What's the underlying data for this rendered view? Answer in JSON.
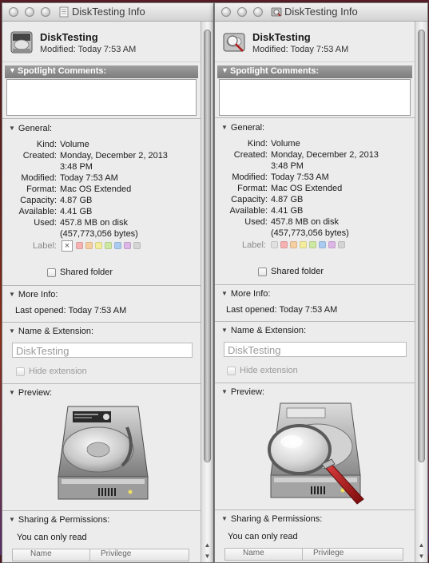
{
  "windows": [
    {
      "id": "left",
      "title": "DiskTesting Info",
      "name": "DiskTesting",
      "modified": "Modified: Today 7:53 AM",
      "spotlight_label": "Spotlight Comments:",
      "general_label": "General:",
      "general": [
        {
          "key": "Kind:",
          "value": "Volume"
        },
        {
          "key": "Created:",
          "value": "Monday, December 2, 2013"
        },
        {
          "key": "",
          "value": "3:48 PM"
        },
        {
          "key": "Modified:",
          "value": "Today 7:53 AM"
        },
        {
          "key": "Format:",
          "value": "Mac OS Extended"
        },
        {
          "key": "Capacity:",
          "value": "4.87 GB"
        },
        {
          "key": "Available:",
          "value": "4.41 GB"
        },
        {
          "key": "Used:",
          "value": "457.8 MB on disk"
        },
        {
          "key": "",
          "value": "(457,773,056 bytes)"
        }
      ],
      "label_text": "Label:",
      "label_none": "×",
      "shared_folder": "Shared folder",
      "more_info_label": "More Info:",
      "last_opened": "Last opened: Today 7:53 AM",
      "name_ext_label": "Name & Extension:",
      "name_value": "DiskTesting",
      "hide_extension": "Hide extension",
      "preview_label": "Preview:",
      "preview_icon": "hard-drive-icon",
      "sharing_label": "Sharing & Permissions:",
      "sharing_text": "You can only read",
      "perm_name": "Name",
      "perm_priv": "Privilege"
    },
    {
      "id": "right",
      "title": "DiskTesting Info",
      "name": "DiskTesting",
      "modified": "Modified: Today 7:53 AM",
      "spotlight_label": "Spotlight Comments:",
      "general_label": "General:",
      "general": [
        {
          "key": "Kind:",
          "value": "Volume"
        },
        {
          "key": "Created:",
          "value": "Monday, December 2, 2013"
        },
        {
          "key": "",
          "value": "3:48 PM"
        },
        {
          "key": "Modified:",
          "value": "Today 7:53 AM"
        },
        {
          "key": "Format:",
          "value": "Mac OS Extended"
        },
        {
          "key": "Capacity:",
          "value": "4.87 GB"
        },
        {
          "key": "Available:",
          "value": "4.41 GB"
        },
        {
          "key": "Used:",
          "value": "457.8 MB on disk"
        },
        {
          "key": "",
          "value": "(457,773,056 bytes)"
        }
      ],
      "label_text": "Label:",
      "label_none": "",
      "shared_folder": "Shared folder",
      "more_info_label": "More Info:",
      "last_opened": "Last opened: Today 7:53 AM",
      "name_ext_label": "Name & Extension:",
      "name_value": "DiskTesting",
      "hide_extension": "Hide extension",
      "preview_label": "Preview:",
      "preview_icon": "hard-drive-magnifier-icon",
      "sharing_label": "Sharing & Permissions:",
      "sharing_text": "You can only read",
      "perm_name": "Name",
      "perm_priv": "Privilege"
    }
  ],
  "label_colors": [
    "#f6b2b2",
    "#f6cfa0",
    "#f3ec9a",
    "#cde8a0",
    "#a9cbef",
    "#dcb6e6",
    "#d4d4d4"
  ]
}
